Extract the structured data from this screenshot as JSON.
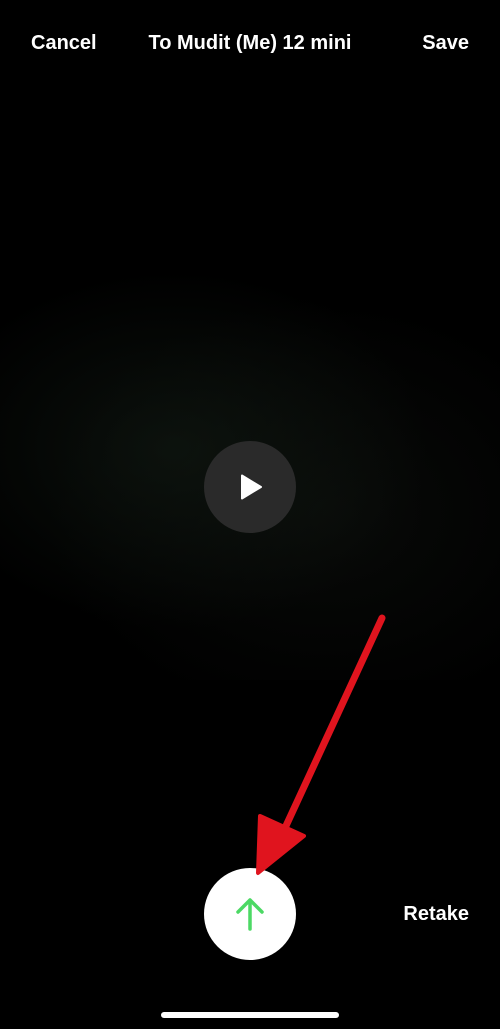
{
  "header": {
    "cancel_label": "Cancel",
    "title": "To Mudit (Me) 12 mini",
    "save_label": "Save"
  },
  "preview": {
    "play_icon": "play-icon"
  },
  "footer": {
    "send_icon": "arrow-up-icon",
    "retake_label": "Retake"
  },
  "colors": {
    "background": "#000000",
    "send_arrow": "#4cd964",
    "annotation_arrow": "#e0141e"
  }
}
